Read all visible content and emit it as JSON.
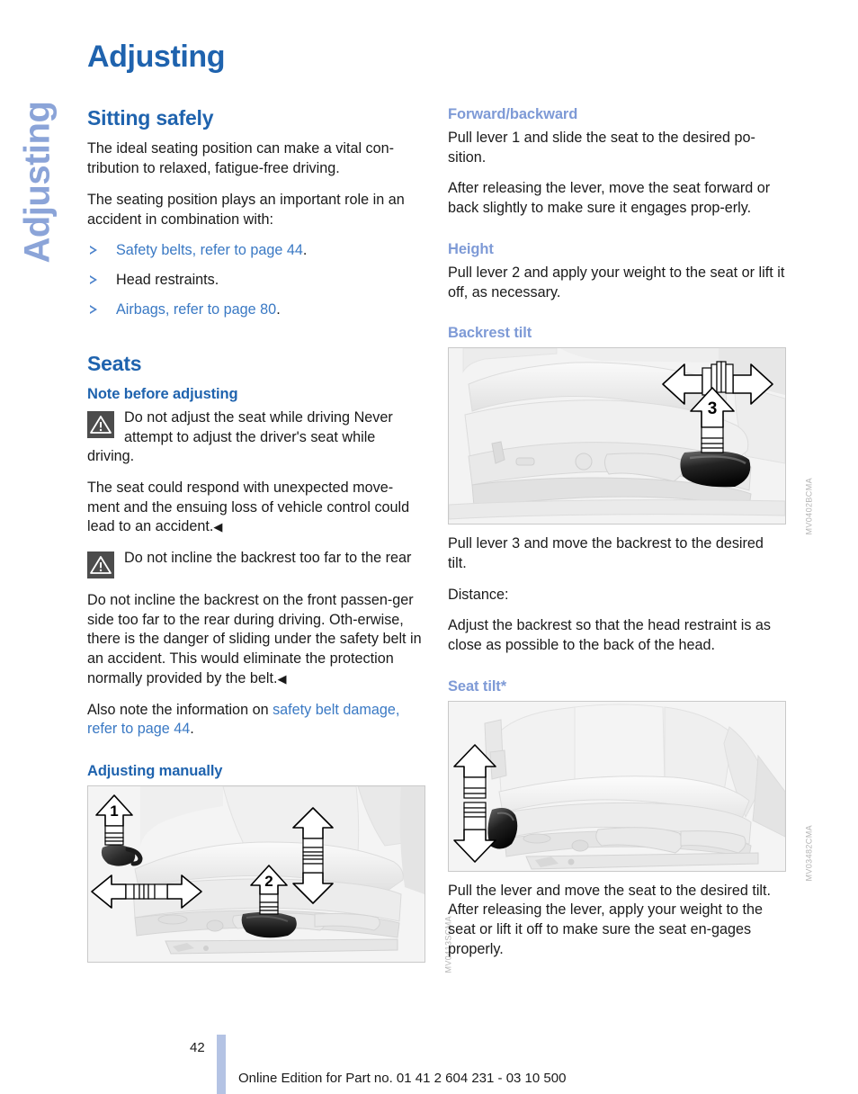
{
  "sidebar": {
    "chapter_label": "Adjusting"
  },
  "header": {
    "title": "Adjusting"
  },
  "left_column": {
    "section_sitting_safely": {
      "heading": "Sitting safely",
      "para1": "The ideal seating position can make a vital con-tribution to relaxed, fatigue-free driving.",
      "para2": "The seating position plays an important role in an accident in combination with:",
      "bullets": [
        {
          "link_text": "Safety belts, refer to page 44",
          "tail": "."
        },
        {
          "plain_text": "Head restraints."
        },
        {
          "link_text": "Airbags, refer to page 80",
          "tail": "."
        }
      ]
    },
    "section_seats": {
      "heading": "Seats",
      "sub_note": "Note before adjusting",
      "warning1": {
        "icon": "warning-triangle-icon",
        "title": "Do not adjust the seat while driving",
        "body": "Never attempt to adjust the driver's seat while driving."
      },
      "warning1_para": "The seat could respond with unexpected move-ment and the ensuing loss of vehicle control could lead to an accident.",
      "warning2": {
        "icon": "warning-triangle-icon",
        "title": "Do not incline the backrest too far to the rear"
      },
      "warning2_para": "Do not incline the backrest on the front passen-ger side too far to the rear during driving. Oth-erwise, there is the danger of sliding under the safety belt in an accident. This would eliminate the protection normally provided by the belt.",
      "also_note_prefix": "Also note the information on ",
      "also_note_link": "safety belt damage, refer to page 44",
      "also_note_tail": ".",
      "sub_adjusting_manually": "Adjusting manually",
      "figure": {
        "alt": "seat-adjusting-manually-illustration",
        "code": "MV0413SCMA",
        "callout_1": "1",
        "callout_2": "2"
      }
    }
  },
  "right_column": {
    "section_forward_backward": {
      "heading": "Forward/backward",
      "para1": "Pull lever 1 and slide the seat to the desired po-sition.",
      "para2": "After releasing the lever, move the seat forward or back slightly to make sure it engages prop-erly."
    },
    "section_height": {
      "heading": "Height",
      "para1": "Pull lever 2 and apply your weight to the seat or lift it off, as necessary."
    },
    "section_backrest_tilt": {
      "heading": "Backrest tilt",
      "figure": {
        "alt": "seat-backrest-tilt-illustration",
        "code": "MV0402BCMA",
        "callout_3": "3"
      },
      "para1": "Pull lever 3 and move the backrest to the desired tilt.",
      "para2": "Distance:",
      "para3": "Adjust the backrest so that the head restraint is as close as possible to the back of the head."
    },
    "section_seat_tilt": {
      "heading": "Seat tilt*",
      "figure": {
        "alt": "seat-tilt-illustration",
        "code": "MV03482CMA"
      },
      "para1": "Pull the lever and move the seat to the desired tilt. After releasing the lever, apply your weight to the seat or lift it off to make sure the seat en-gages properly."
    }
  },
  "footer": {
    "page_number": "42",
    "text": "Online Edition for Part no. 01 41 2 604 231 - 03 10 500"
  },
  "colors": {
    "heading_blue": "#1f63ae",
    "subheading_light_blue": "#7e9ad6",
    "link_blue": "#3a79c4",
    "sidetab_blue": "#8ba4d8",
    "footer_bar": "#b4c3e4",
    "warning_icon_bg": "#4c4c4c"
  }
}
